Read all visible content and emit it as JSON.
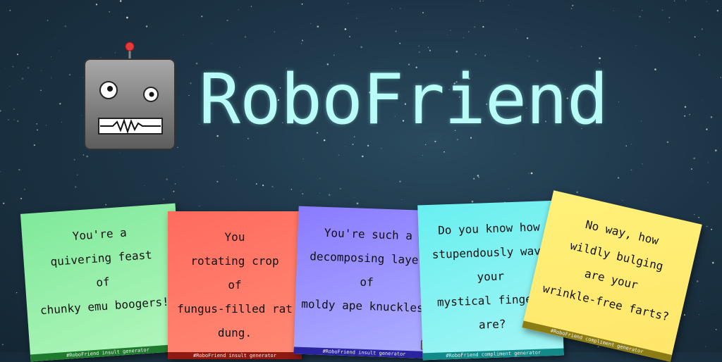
{
  "app": {
    "title": "RoboFriend"
  },
  "colors": {
    "title": "#b8fbf7",
    "background": "#1d3547"
  },
  "icons": {
    "logo": "robot-icon"
  },
  "cards": [
    {
      "lines": [
        "You're a",
        "quivering feast",
        "of",
        "chunky emu boogers!"
      ],
      "footer": "#RoboFriend insult generator",
      "color": "#7fe99a"
    },
    {
      "lines": [
        "You",
        "rotating crop",
        "of",
        "fungus-filled rat",
        "dung."
      ],
      "footer": "#RoboFriend insult generator",
      "color": "#ff6b5d"
    },
    {
      "lines": [
        "You're such a",
        "decomposing layer",
        "of",
        "moldy ape knuckles!"
      ],
      "footer": "#RoboFriend insult generator",
      "color": "#8a7bff"
    },
    {
      "lines": [
        "Do you know how",
        "stupendously wavy",
        "your",
        "mystical fingers",
        "are?"
      ],
      "footer": "#RoboFriend compliment generator",
      "color": "#68efef"
    },
    {
      "lines": [
        "No way, how",
        "wildly bulging",
        "are your",
        "wrinkle-free farts?"
      ],
      "footer": "#RoboFriend compliment generator",
      "color": "#fff17a"
    }
  ]
}
